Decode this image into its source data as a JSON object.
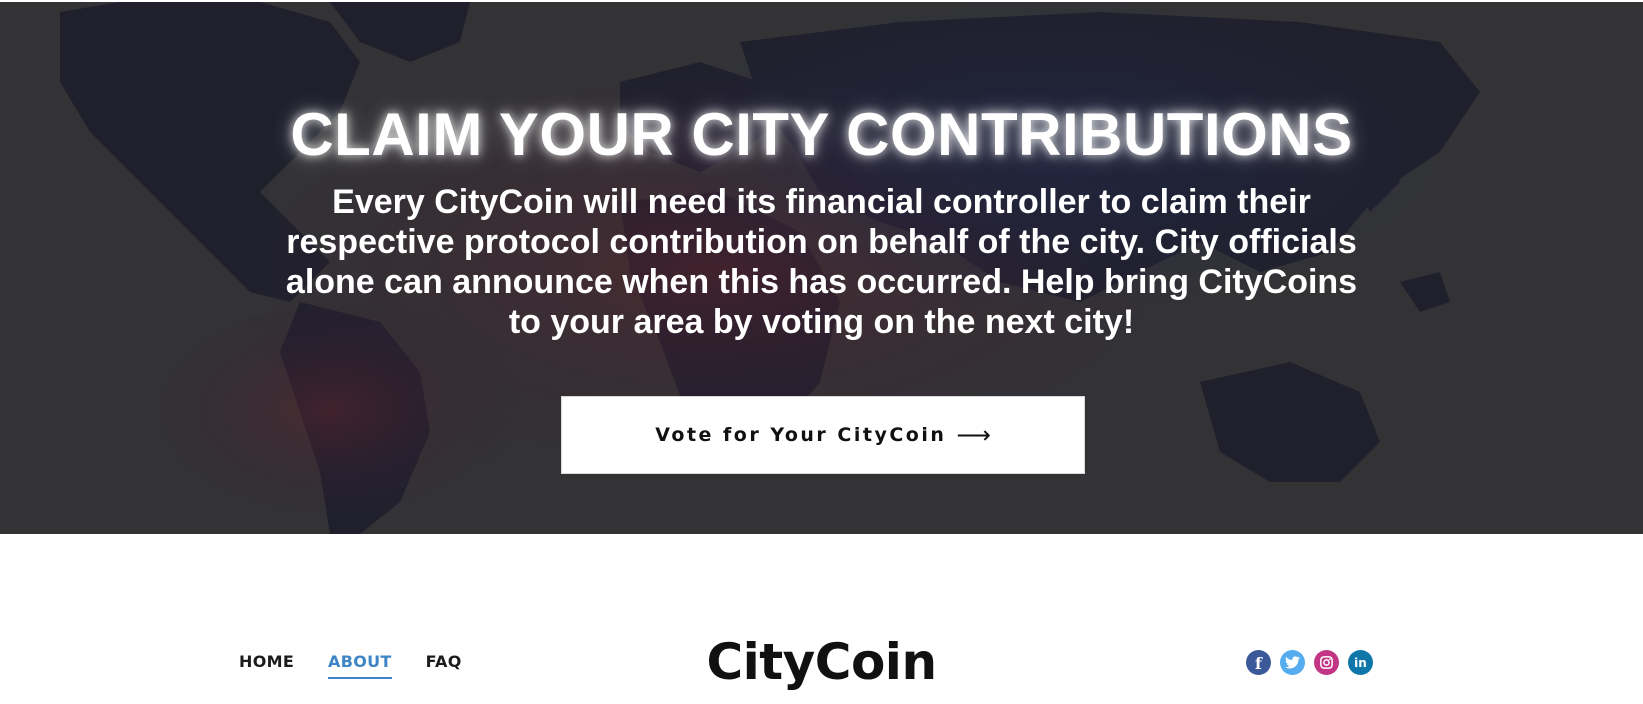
{
  "hero": {
    "title": "CLAIM YOUR CITY CONTRIBUTIONS",
    "text": "Every CityCoin will need its financial controller to claim their respective protocol contribution on behalf of the city. City officials alone can announce when this has occurred. Help bring CityCoins to your area by voting on the next city!",
    "button_label": "Vote for Your CityCoin",
    "button_arrow": "⟶",
    "background_icon": "world-map-icon"
  },
  "nav": {
    "items": [
      {
        "label": "HOME",
        "active": false
      },
      {
        "label": "ABOUT",
        "active": true
      },
      {
        "label": "FAQ",
        "active": false
      }
    ],
    "brand": "CityCoin",
    "social": [
      {
        "name": "facebook-icon",
        "glyph": "f",
        "color": "#3b5998"
      },
      {
        "name": "twitter-icon",
        "glyph": "",
        "color": "#55acee"
      },
      {
        "name": "instagram-icon",
        "glyph": "",
        "color": "#c13584"
      },
      {
        "name": "linkedin-icon",
        "glyph": "in",
        "color": "#0e76a8"
      }
    ]
  },
  "colors": {
    "hero_background": "#3a3a3c",
    "accent": "#3f85c6",
    "text_dark": "#111111"
  }
}
